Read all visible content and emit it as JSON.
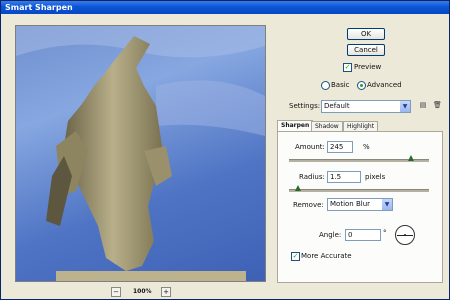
{
  "window": {
    "title": "Smart Sharpen"
  },
  "preview": {
    "zoom": "100%",
    "zoom_out": "−",
    "zoom_in": "+"
  },
  "buttons": {
    "ok": "OK",
    "cancel": "Cancel"
  },
  "preview_toggle": {
    "label": "Preview",
    "checked": true
  },
  "mode": {
    "basic": "Basic",
    "advanced": "Advanced",
    "selected": "advanced"
  },
  "settings": {
    "label": "Settings:",
    "value": "Default"
  },
  "tabs": [
    {
      "label": "Sharpen",
      "active": true
    },
    {
      "label": "Shadow",
      "active": false
    },
    {
      "label": "Highlight",
      "active": false
    }
  ],
  "amount": {
    "label": "Amount:",
    "value": "245",
    "unit": "%"
  },
  "radius": {
    "label": "Radius:",
    "value": "1.5",
    "unit": "pixels"
  },
  "remove": {
    "label": "Remove:",
    "value": "Motion Blur"
  },
  "angle": {
    "label": "Angle:",
    "value": "0",
    "unit": "°"
  },
  "more_accurate": {
    "label": "More Accurate",
    "checked": true
  },
  "icons": {
    "save_settings": "save-icon",
    "delete_settings": "trash-icon"
  }
}
